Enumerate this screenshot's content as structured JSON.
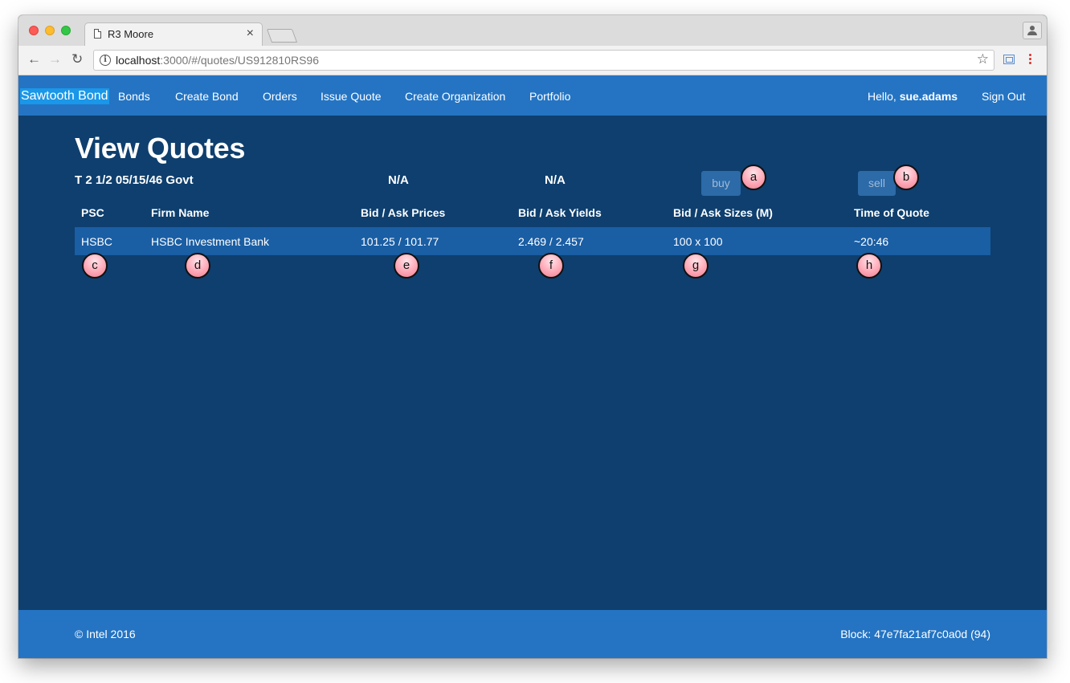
{
  "browser": {
    "tab_title": "R3 Moore",
    "tab_close": "×",
    "url_host": "localhost",
    "url_rest": ":3000/#/quotes/US912810RS96",
    "back": "←",
    "forward": "→",
    "reload": "↻",
    "star": "☆",
    "info": "i"
  },
  "nav": {
    "brand": "Sawtooth Bond",
    "links": [
      "Bonds",
      "Create Bond",
      "Orders",
      "Issue Quote",
      "Create Organization",
      "Portfolio"
    ],
    "hello": "Hello, ",
    "username": "sue.adams",
    "sign_out": "Sign Out"
  },
  "page": {
    "title": "View Quotes",
    "bond_name": "T 2 1/2 05/15/46 Govt",
    "price_summary": "N/A",
    "yield_summary": "N/A",
    "buy_label": "buy",
    "sell_label": "sell"
  },
  "table": {
    "headers": [
      "PSC",
      "Firm Name",
      "Bid / Ask Prices",
      "Bid / Ask Yields",
      "Bid / Ask Sizes (M)",
      "Time of Quote"
    ],
    "rows": [
      [
        "HSBC",
        "HSBC Investment Bank",
        "101.25 / 101.77",
        "2.469 / 2.457",
        "100 x 100",
        "~20:46"
      ]
    ]
  },
  "markers": [
    "a",
    "b",
    "c",
    "d",
    "e",
    "f",
    "g",
    "h"
  ],
  "footer": {
    "copyright": "© Intel 2016",
    "block": "Block: 47e7fa21af7c0a0d (94)"
  },
  "colors": {
    "navbar": "#2474c3",
    "content_bg": "#0e3f6e",
    "row_bg": "#1a5ea4",
    "brand_highlight": "#1a97e8",
    "button": "#2c6aa8",
    "marker_fill": "#ffb3c0"
  }
}
